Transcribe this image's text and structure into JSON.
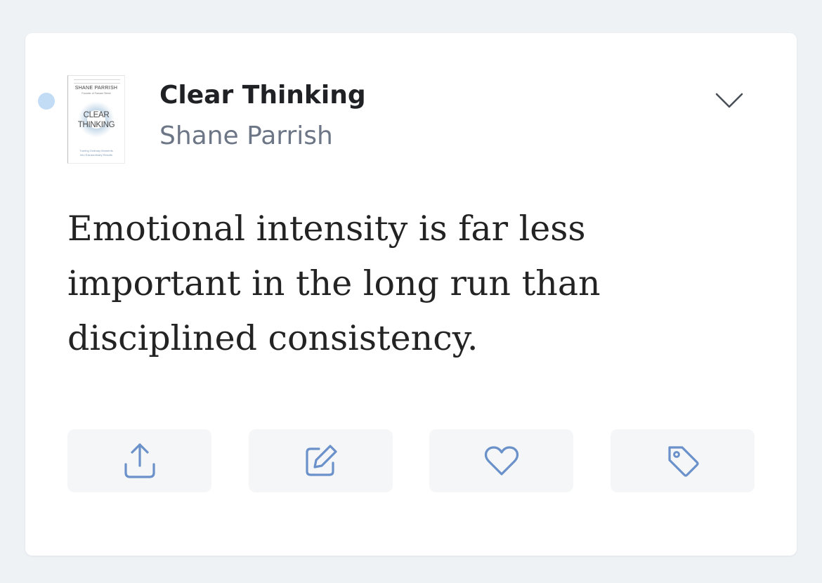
{
  "highlight": {
    "book": {
      "title": "Clear Thinking",
      "author": "Shane Parrish",
      "cover": {
        "author": "SHANE PARRISH",
        "subauthor": "Founder of Farnam Street",
        "title_line1": "CLEAR",
        "title_line2": "THINKING",
        "tagline_line1": "Turning Ordinary Moments",
        "tagline_line2": "into Extraordinary Results"
      }
    },
    "text": "Emotional intensity is far less important in the long run than disciplined consistency.",
    "unread": true
  },
  "actions": [
    {
      "name": "share",
      "icon": "share-icon"
    },
    {
      "name": "edit",
      "icon": "edit-icon"
    },
    {
      "name": "like",
      "icon": "heart-icon"
    },
    {
      "name": "tag",
      "icon": "tag-icon"
    }
  ],
  "colors": {
    "background": "#eff2f5",
    "card": "#ffffff",
    "title": "#1f2125",
    "author": "#6d7686",
    "quote": "#232323",
    "accent_icon": "#6a91c9",
    "unread_dot": "#c2dcf6",
    "button_bg": "#f5f6f8"
  }
}
